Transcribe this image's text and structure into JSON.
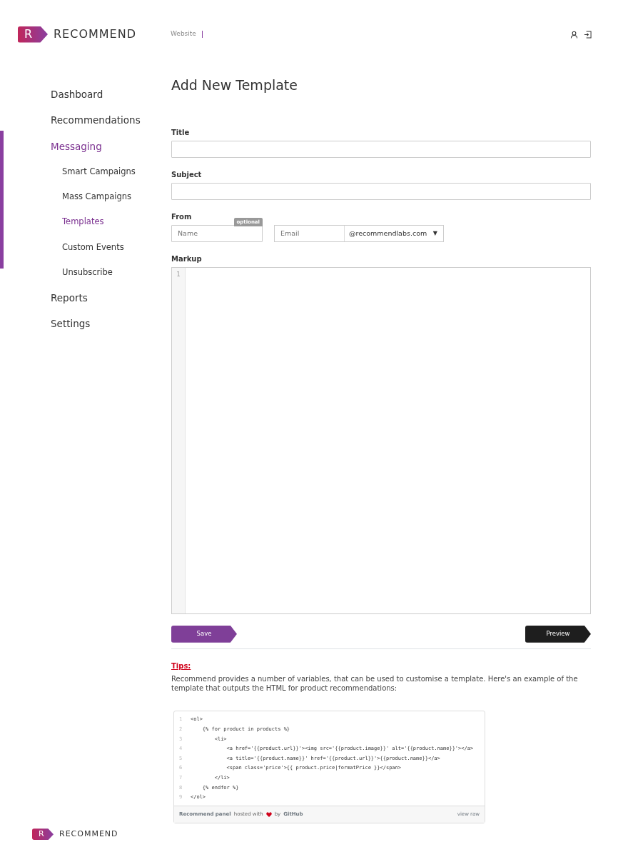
{
  "header": {
    "logo_letter": "R",
    "brand": "RECOMMEND",
    "site_label": "Website"
  },
  "sidebar": {
    "items": [
      {
        "label": "Dashboard",
        "selected": false
      },
      {
        "label": "Recommendations",
        "selected": false
      },
      {
        "label": "Messaging",
        "selected": true,
        "children": [
          {
            "label": "Smart Campaigns",
            "selected": false
          },
          {
            "label": "Mass Campaigns",
            "selected": false
          },
          {
            "label": "Templates",
            "selected": true
          },
          {
            "label": "Custom Events",
            "selected": false
          },
          {
            "label": "Unsubscribe",
            "selected": false
          }
        ]
      },
      {
        "label": "Reports",
        "selected": false
      },
      {
        "label": "Settings",
        "selected": false
      }
    ]
  },
  "page_title": "Add New Template",
  "form": {
    "title_label": "Title",
    "subject_label": "Subject",
    "from_label": "From",
    "optional_badge": "optional",
    "name_placeholder": "Name",
    "email_placeholder": "Email",
    "email_domain": "@recommendlabs.com",
    "dropdown_arrow": "▼",
    "markup_label": "Markup",
    "editor_line_numbers": [
      "1"
    ]
  },
  "buttons": {
    "save": "Save",
    "preview": "Preview"
  },
  "tips": {
    "heading": "Tips:",
    "text": "Recommend provides a number of variables, that can be used to customise a template. Here's an example of the template that outputs the HTML for product recommendations:"
  },
  "code_sample": {
    "lines": [
      {
        "number": "1",
        "code": "<ol>"
      },
      {
        "number": "2",
        "code": "    {% for product in products %}"
      },
      {
        "number": "3",
        "code": "        <li>"
      },
      {
        "number": "4",
        "code": "            <a href='{{product.url}}'><img src='{{product.image}}' alt='{{product.name}}'></a>"
      },
      {
        "number": "5",
        "code": "            <a title='{{product.name}}' href='{{product.url}}'>{{product.name}}</a>"
      },
      {
        "number": "6",
        "code": "            <span class='price'>{{ product.price|formatPrice }}</span>"
      },
      {
        "number": "7",
        "code": "        </li>"
      },
      {
        "number": "8",
        "code": "    {% endfor %}"
      },
      {
        "number": "9",
        "code": "</ol>"
      }
    ],
    "footer": {
      "file": "Recommend panel",
      "hosted_text": "hosted with",
      "by_text": "by",
      "host": "GitHub",
      "raw_link": "view raw"
    }
  },
  "footer": {
    "logo_letter": "R",
    "brand": "RECOMMEND"
  }
}
